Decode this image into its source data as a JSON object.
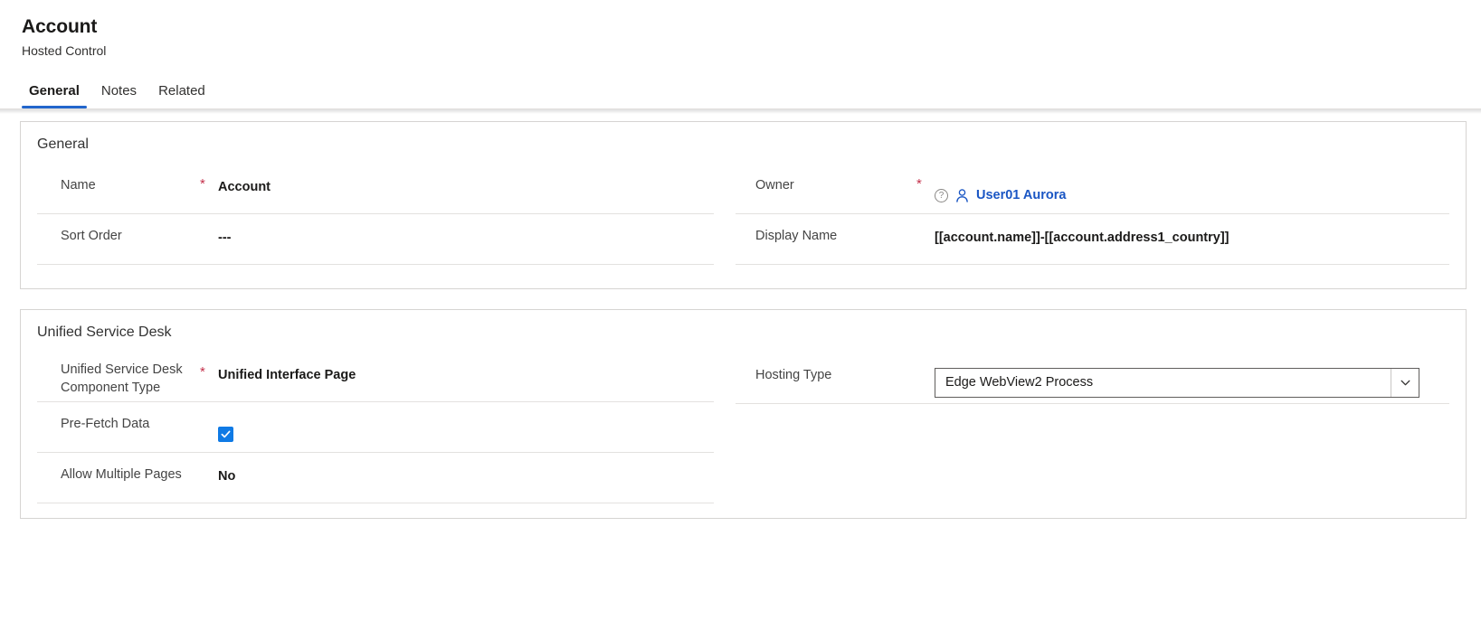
{
  "header": {
    "title": "Account",
    "subtitle": "Hosted Control"
  },
  "tabs": [
    {
      "label": "General",
      "selected": true
    },
    {
      "label": "Notes",
      "selected": false
    },
    {
      "label": "Related",
      "selected": false
    }
  ],
  "sections": {
    "general": {
      "title": "General",
      "fields": {
        "name": {
          "label": "Name",
          "required": "*",
          "value": "Account"
        },
        "sort_order": {
          "label": "Sort Order",
          "value": "---"
        },
        "owner": {
          "label": "Owner",
          "required": "*",
          "help_icon": "?",
          "value": "User01 Aurora"
        },
        "display_name": {
          "label": "Display Name",
          "value": "[[account.name]]-[[account.address1_country]]"
        }
      }
    },
    "unified_service_desk": {
      "title": "Unified Service Desk",
      "fields": {
        "component_type": {
          "label": "Unified Service Desk Component Type",
          "required": "*",
          "value": "Unified Interface Page"
        },
        "pre_fetch_data": {
          "label": "Pre-Fetch Data",
          "checked": true
        },
        "allow_multiple_pages": {
          "label": "Allow Multiple Pages",
          "value": "No"
        },
        "hosting_type": {
          "label": "Hosting Type",
          "value": "Edge WebView2 Process"
        }
      }
    }
  },
  "colors": {
    "accent": "#2266cc",
    "link": "#1a56c4",
    "required": "#c4314b",
    "checkbox": "#0f7ae5"
  }
}
